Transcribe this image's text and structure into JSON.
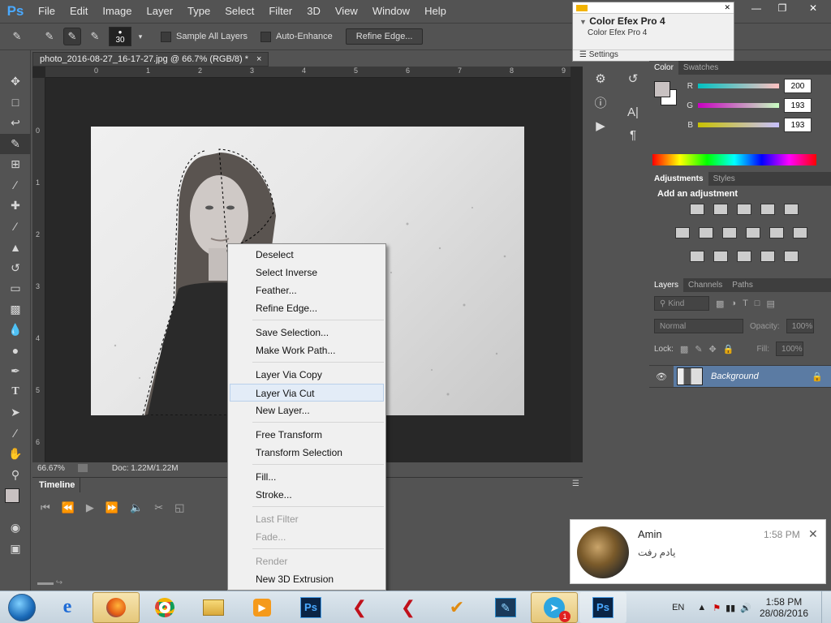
{
  "app": {
    "logo": "Ps",
    "menu": [
      "File",
      "Edit",
      "Image",
      "Layer",
      "Type",
      "Select",
      "Filter",
      "3D",
      "View",
      "Window",
      "Help"
    ]
  },
  "options_bar": {
    "brush_size": "30",
    "sample_all_layers": "Sample All Layers",
    "auto_enhance": "Auto-Enhance",
    "refine_edge": "Refine Edge..."
  },
  "document": {
    "tab_title": "photo_2016-08-27_16-17-27.jpg @ 66.7% (RGB/8) *",
    "close": "×",
    "zoom": "66.67%",
    "doc_info": "Doc: 1.22M/1.22M",
    "ruler_top": [
      "0",
      "1",
      "2",
      "3",
      "4",
      "5",
      "6",
      "7",
      "8",
      "9"
    ],
    "ruler_left": [
      "0",
      "1",
      "2",
      "3",
      "4",
      "5",
      "6"
    ]
  },
  "timeline": {
    "tab": "Timeline"
  },
  "color_efex": {
    "title": "Color Efex Pro 4",
    "subtitle": "Color Efex Pro 4",
    "settings": "Settings"
  },
  "color_panel": {
    "tabs": [
      "Color",
      "Swatches"
    ],
    "r_label": "R",
    "g_label": "G",
    "b_label": "B",
    "r": "200",
    "g": "193",
    "b": "193"
  },
  "adjustments_panel": {
    "tabs": [
      "Adjustments",
      "Styles"
    ],
    "heading": "Add an adjustment"
  },
  "layers_panel": {
    "tabs": [
      "Layers",
      "Channels",
      "Paths"
    ],
    "kind": "Kind",
    "blend_mode": "Normal",
    "opacity_label": "Opacity:",
    "opacity": "100%",
    "lock_label": "Lock:",
    "fill_label": "Fill:",
    "fill": "100%",
    "layer_name": "Background"
  },
  "context_menu": {
    "items": [
      {
        "label": "Deselect"
      },
      {
        "label": "Select Inverse"
      },
      {
        "label": "Feather..."
      },
      {
        "label": "Refine Edge..."
      },
      {
        "label": "Save Selection..."
      },
      {
        "label": "Make Work Path..."
      },
      {
        "label": "Layer Via Copy"
      },
      {
        "label": "Layer Via Cut",
        "highlighted": true
      },
      {
        "label": "New Layer..."
      },
      {
        "label": "Free Transform"
      },
      {
        "label": "Transform Selection"
      },
      {
        "label": "Fill..."
      },
      {
        "label": "Stroke..."
      },
      {
        "label": "Last Filter",
        "disabled": true
      },
      {
        "label": "Fade...",
        "disabled": true
      },
      {
        "label": "Render",
        "disabled": true
      },
      {
        "label": "New 3D Extrusion"
      }
    ]
  },
  "notification": {
    "name": "Amin",
    "time": "1:58 PM",
    "message": "یادم رفت",
    "close": "✕"
  },
  "taskbar": {
    "language": "EN",
    "time": "1:58 PM",
    "date": "28/08/2016",
    "badge": "1"
  }
}
